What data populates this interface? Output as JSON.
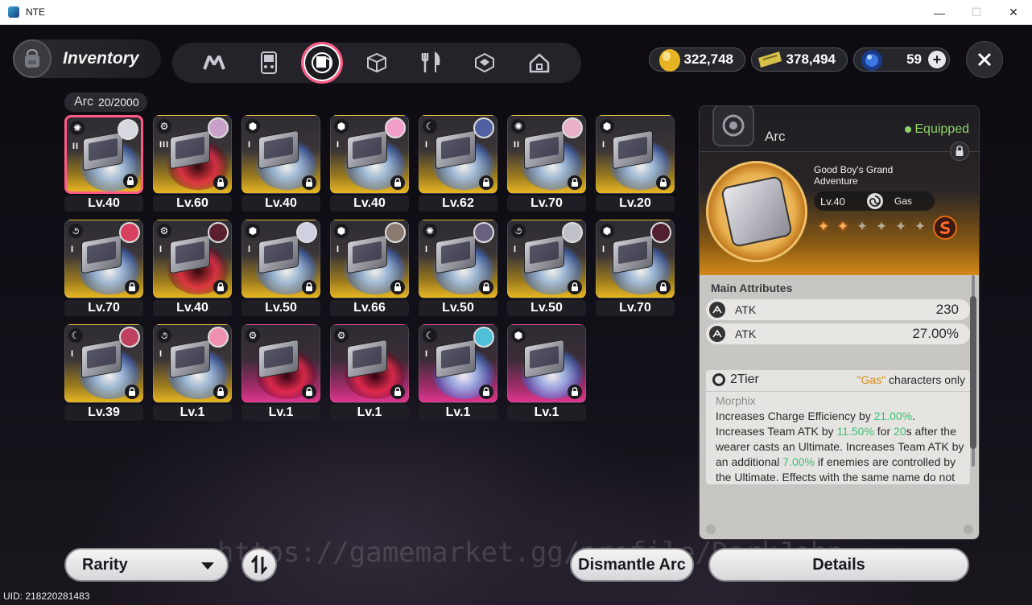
{
  "window": {
    "title": "NTE",
    "buttons": {
      "minimize": "—",
      "maximize": "☐",
      "close": "✕"
    }
  },
  "header": {
    "title": "Inventory",
    "tabs": [
      {
        "icon": "nte-logo-icon",
        "active": false
      },
      {
        "icon": "gameboy-icon",
        "active": false
      },
      {
        "icon": "arc-disc-icon",
        "active": true
      },
      {
        "icon": "cube-icon",
        "active": false
      },
      {
        "icon": "fork-knife-icon",
        "active": false
      },
      {
        "icon": "gem-box-icon",
        "active": false
      },
      {
        "icon": "house-icon",
        "active": false
      }
    ]
  },
  "currencies": [
    {
      "icon": "gold-egg-icon",
      "value": "322,748",
      "color": "#e6b422"
    },
    {
      "icon": "ticket-icon",
      "value": "378,494",
      "color": "#d6c04a"
    },
    {
      "icon": "blue-orb-icon",
      "value": "59",
      "color": "#3a78e0",
      "add": "+"
    }
  ],
  "arc_count": {
    "label": "Arc",
    "count": "20/2000"
  },
  "items": [
    {
      "level": "Lv.40",
      "tier": "II",
      "rarity": "gold",
      "swirl": "blue",
      "element": "gas",
      "selected": true,
      "avatar_color": "#d8d8e0"
    },
    {
      "level": "Lv.60",
      "tier": "III",
      "rarity": "gold",
      "swirl": "red",
      "element": "gear",
      "avatar_color": "#c8a0c8"
    },
    {
      "level": "Lv.40",
      "tier": "I",
      "rarity": "gold",
      "swirl": "blue",
      "element": "cube",
      "avatar_color": null
    },
    {
      "level": "Lv.40",
      "tier": "I",
      "rarity": "gold",
      "swirl": "blue",
      "element": "cube",
      "avatar_color": "#f0a0c8"
    },
    {
      "level": "Lv.62",
      "tier": "I",
      "rarity": "gold",
      "swirl": "blue",
      "element": "moon",
      "avatar_color": "#5060a0"
    },
    {
      "level": "Lv.70",
      "tier": "II",
      "rarity": "gold",
      "swirl": "blue",
      "element": "gas",
      "avatar_color": "#e8b0c8"
    },
    {
      "level": "Lv.20",
      "tier": "I",
      "rarity": "gold",
      "swirl": "blue",
      "element": "cube",
      "avatar_color": null
    },
    {
      "level": "Lv.70",
      "tier": "I",
      "rarity": "gold",
      "swirl": "blue",
      "element": "swirl",
      "avatar_color": "#d84060"
    },
    {
      "level": "Lv.40",
      "tier": "I",
      "rarity": "gold",
      "swirl": "red",
      "element": "gear",
      "avatar_color": "#5a2030"
    },
    {
      "level": "Lv.50",
      "tier": "I",
      "rarity": "gold",
      "swirl": "blue",
      "element": "cube",
      "avatar_color": "#d0d0e0"
    },
    {
      "level": "Lv.66",
      "tier": "I",
      "rarity": "gold",
      "swirl": "blue",
      "element": "cube",
      "avatar_color": "#8a7a70"
    },
    {
      "level": "Lv.50",
      "tier": "I",
      "rarity": "gold",
      "swirl": "blue",
      "element": "gas",
      "avatar_color": "#6a6080"
    },
    {
      "level": "Lv.50",
      "tier": "I",
      "rarity": "gold",
      "swirl": "blue",
      "element": "swirl",
      "avatar_color": "#c0c0c8"
    },
    {
      "level": "Lv.70",
      "tier": "I",
      "rarity": "gold",
      "swirl": "blue",
      "element": "cube",
      "avatar_color": "#502030"
    },
    {
      "level": "Lv.39",
      "tier": "I",
      "rarity": "gold",
      "swirl": "blue",
      "element": "moon",
      "avatar_color": "#c04060"
    },
    {
      "level": "Lv.1",
      "tier": "I",
      "rarity": "gold",
      "swirl": "blue",
      "element": "swirl",
      "avatar_color": "#f090b0"
    },
    {
      "level": "Lv.1",
      "tier": "",
      "rarity": "pink",
      "swirl": "red",
      "element": "gear",
      "avatar_color": null
    },
    {
      "level": "Lv.1",
      "tier": "",
      "rarity": "pink",
      "swirl": "red",
      "element": "gear",
      "avatar_color": null
    },
    {
      "level": "Lv.1",
      "tier": "I",
      "rarity": "pink",
      "swirl": "blue",
      "element": "moon",
      "avatar_color": "#50c0d8"
    },
    {
      "level": "Lv.1",
      "tier": "",
      "rarity": "pink",
      "swirl": "blue",
      "element": "cube",
      "avatar_color": null
    }
  ],
  "detail": {
    "type": "Arc",
    "equipped": "Equipped",
    "name": "Good Boy's Grand Adventure",
    "level": "Lv.40",
    "element": "Gas",
    "stars_on": 2,
    "stars_total": 7,
    "stats_title": "Main Attributes",
    "attributes": [
      {
        "name": "ATK",
        "value": "230"
      },
      {
        "name": "ATK",
        "value": "27.00%"
      }
    ],
    "set_tier": "2Tier",
    "set_req_gas": "\"Gas\"",
    "set_req_rest": " characters only",
    "set_name": "Morphix",
    "desc_parts": [
      {
        "t": "Increases Charge Efficiency by "
      },
      {
        "t": "21.00%",
        "hl": true
      },
      {
        "t": ". Increases Team ATK by "
      },
      {
        "t": "11.50%",
        "hl": true
      },
      {
        "t": " for "
      },
      {
        "t": "20",
        "hl": true
      },
      {
        "t": "s after the wearer casts an Ultimate. Increases Team ATK by an additional "
      },
      {
        "t": "7.00%",
        "hl": true
      },
      {
        "t": " if enemies are controlled by the Ultimate. Effects with the same name do not stack."
      }
    ]
  },
  "bottom": {
    "rarity_label": "Rarity",
    "dismantle_label": "Dismantle Arc",
    "details_label": "Details",
    "watermark": "https://gamemarket.gg/profile/DarkJohn",
    "uid": "UID: 218220281483"
  }
}
